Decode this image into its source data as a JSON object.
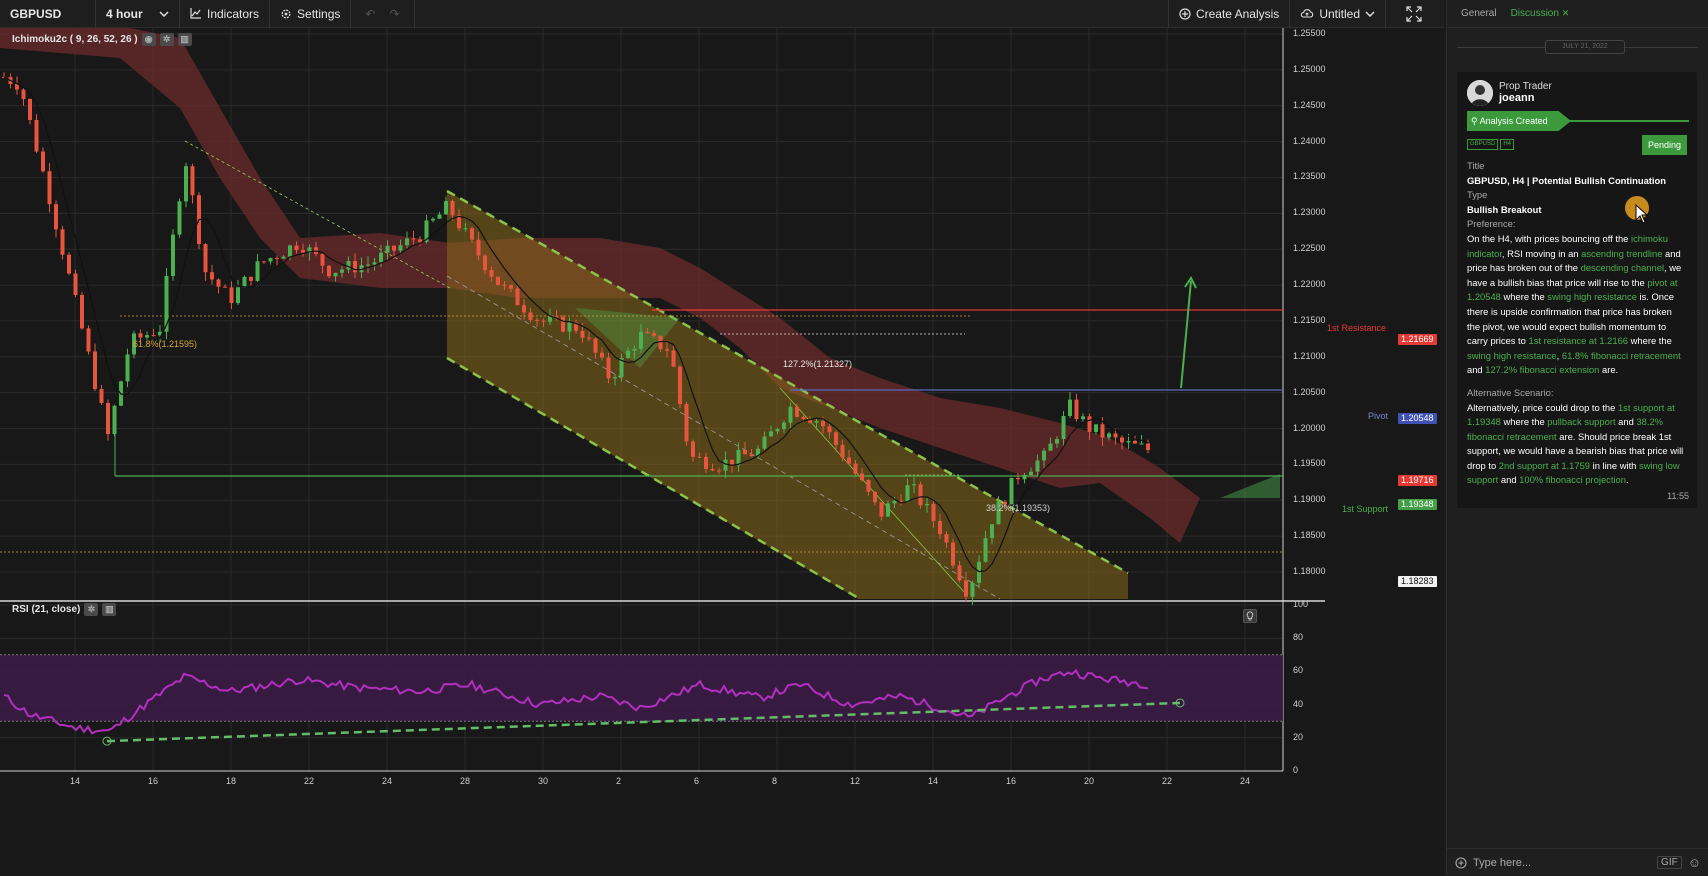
{
  "toolbar": {
    "symbol": "GBPUSD",
    "interval": "4 hour",
    "indicators_label": "Indicators",
    "settings_label": "Settings",
    "create_analysis_label": "Create Analysis",
    "layout_name": "Untitled"
  },
  "chart": {
    "main_study": "Ichimoku2c ( 9, 26, 52, 26 )",
    "rsi_study": "RSI (21, close)",
    "price_axis": [
      "1.25500",
      "1.25000",
      "1.24500",
      "1.24000",
      "1.23500",
      "1.23000",
      "1.22500",
      "1.22000",
      "1.21500",
      "1.21000",
      "1.20500",
      "1.20000",
      "1.19500",
      "1.19000",
      "1.18500",
      "1.18000"
    ],
    "rsi_axis": [
      "100",
      "80",
      "60",
      "40",
      "20",
      "0"
    ],
    "time_axis": [
      "14",
      "16",
      "18",
      "22",
      "24",
      "28",
      "30",
      "2",
      "6",
      "8",
      "12",
      "14",
      "16",
      "20",
      "22",
      "24"
    ],
    "price_tags": {
      "resistance_value": "1.21669",
      "pivot_value": "1.20548",
      "last_price": "1.19716",
      "support_value": "1.19348",
      "crosshair_value": "1.18283"
    },
    "annotations": {
      "resistance_label": "1st Resistance",
      "pivot_label": "Pivot",
      "support_label": "1st Support",
      "fib_618": "61.8%(1.21595)",
      "fib_1272": "127.2%(1.21327)",
      "fib_382": "38.2%(1.19353)"
    },
    "colors": {
      "bull": "#4caf50",
      "bear": "#e8553e",
      "cloud": "#6b2a2a",
      "channel": "#8a6a1c",
      "resistance": "#e53935",
      "pivot": "#5c6bc0",
      "support": "#4caf50",
      "rsi": "#b32fc0"
    }
  },
  "panel": {
    "tab_general": "General",
    "tab_discussion": "Discussion",
    "date_separator": "JULY 21, 2022",
    "card": {
      "role": "Prop Trader",
      "username": "joeann",
      "banner": "Analysis Created",
      "tag_symbol": "GBPUSD",
      "tag_tf": "H4",
      "status": "Pending",
      "title_label": "Title",
      "title_value": "GBPUSD, H4 | Potential Bullish Continuation",
      "type_label": "Type",
      "type_value": "Bullish Breakout",
      "preference_label": "Preference:",
      "p1": "On the H4, with prices bouncing off the ",
      "p1_g1": "ichimoku indicator",
      "p2": ", RSI moving in an ",
      "p2_g": "ascending trendline",
      "p3": " and price has broken out of the ",
      "p3_g": "descending channel",
      "p4": ", we have a bullish bias that price will rise to the ",
      "p4_g": "pivot at 1.20548",
      "p5": " where the ",
      "p5_g": "swing high resistance",
      "p6": " is. Once there is upside confirmation that price has broken the pivot, we would expect bullish momentum to carry prices to ",
      "p6_g": "1st resistance at 1.2166",
      "p7": " where the ",
      "p7_g": "swing high resistance",
      "p8": ", ",
      "p8_g": "61.8% fibonacci retracement",
      "p9": " and ",
      "p9_g": "127.2% fibonacci extension",
      "p10": " are.",
      "alt_label": "Alternative Scenario:",
      "a1": "Alternatively, price could drop to the ",
      "a1_g": "1st support at 1.19348",
      "a2": " where the ",
      "a2_g": "pullback support",
      "a3": " and ",
      "a3_g": "38.2% fibonacci retracement",
      "a4": " are. Should price break 1st support, we would have a bearish bias that price will drop to ",
      "a4_g": "2nd support at 1.1759",
      "a5": " in line with ",
      "a5_g": "swing low support",
      "a6": " and ",
      "a6_g": "100% fibonacci projection",
      "a7": ".",
      "time": "11:55"
    },
    "composer_placeholder": "Type here...",
    "gif_label": "GIF"
  }
}
